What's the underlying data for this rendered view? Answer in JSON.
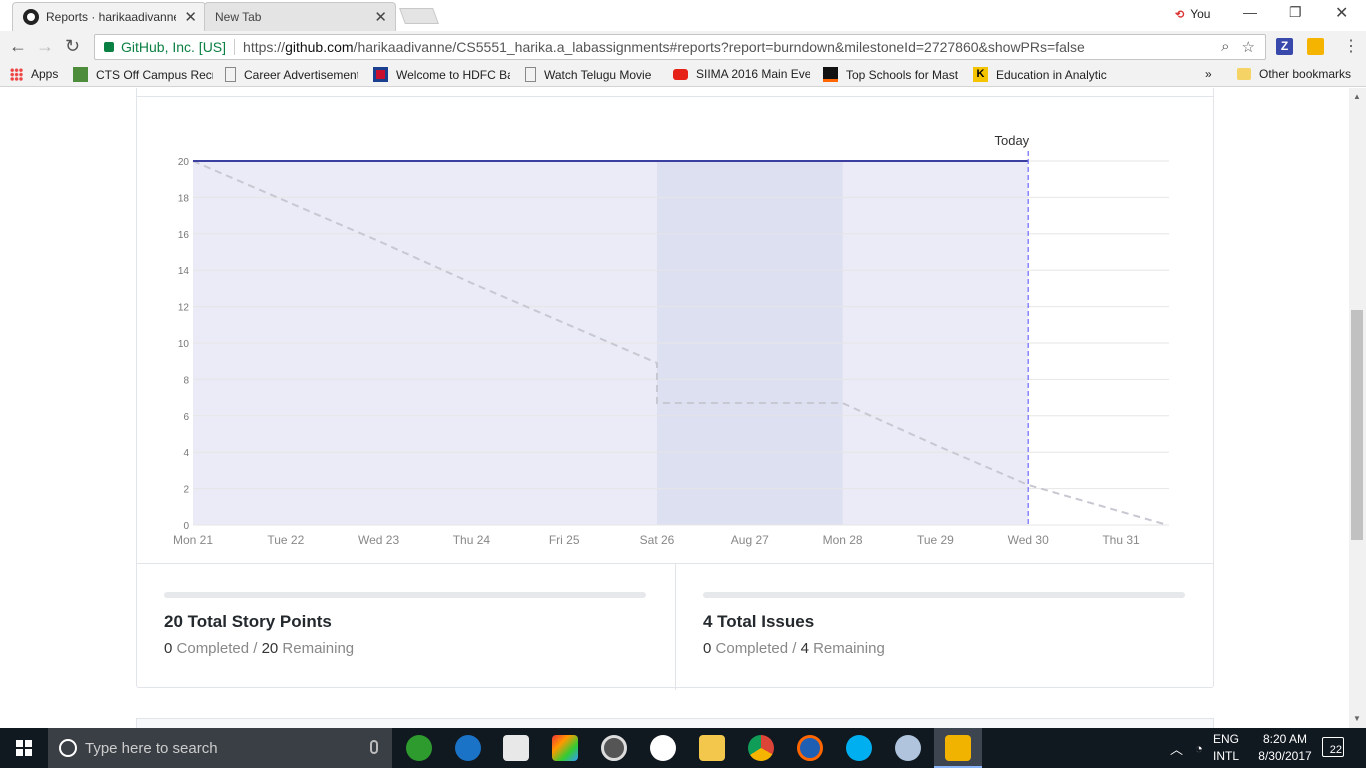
{
  "browser": {
    "tabs": [
      {
        "label": "Reports · harikaadivanne",
        "active": true
      },
      {
        "label": "New Tab",
        "active": false
      }
    ],
    "profile_label": "You",
    "security_label": "GitHub, Inc. [US]",
    "url_prefix": "https://",
    "url_host": "github.com",
    "url_path": "/harikaadivanne/CS5551_harika.a_labassignments#reports?report=burndown&milestoneId=2727860&showPRs=false",
    "extension_z_label": "Z"
  },
  "bookmarks": {
    "items": [
      {
        "label": "Apps",
        "icon": "apps-grid-icon"
      },
      {
        "label": "CTS Off Campus Recr",
        "icon": "checklist-icon"
      },
      {
        "label": "Career Advertisement",
        "icon": "page-icon"
      },
      {
        "label": "Welcome to HDFC Ba",
        "icon": "hdfc-icon"
      },
      {
        "label": "Watch Telugu Movie",
        "icon": "page-icon"
      },
      {
        "label": "SIIMA 2016 Main Eve",
        "icon": "youtube-icon"
      },
      {
        "label": "Top Schools for Mast",
        "icon": "wave-icon"
      },
      {
        "label": "Education in Analytic",
        "icon": "k-icon"
      }
    ],
    "overflow_label": "»",
    "other_label": "Other bookmarks"
  },
  "chart_data": {
    "type": "line",
    "title": "",
    "xlabel": "",
    "ylabel": "",
    "ylim": [
      0,
      20
    ],
    "y_ticks": [
      0,
      2,
      4,
      6,
      8,
      10,
      12,
      14,
      16,
      18,
      20
    ],
    "categories": [
      "Mon 21",
      "Tue 22",
      "Wed 23",
      "Thu 24",
      "Fri 25",
      "Sat 26",
      "Aug 27",
      "Mon 28",
      "Tue 29",
      "Wed 30",
      "Thu 31"
    ],
    "series": [
      {
        "values": [
          20,
          20,
          20,
          20,
          20,
          20,
          20,
          20,
          20,
          20
        ],
        "color": "#3b40a0",
        "style": "solid"
      },
      {
        "values": [
          20,
          17.8,
          15.6,
          13.3,
          11.1,
          8.9,
          6.7,
          6.7,
          6.7,
          4.4,
          2.2,
          0
        ],
        "x_index": [
          0,
          1,
          2,
          3,
          4,
          5,
          5,
          6,
          7,
          8,
          9,
          10.5
        ],
        "color": "#c8c8d2",
        "style": "dashed"
      }
    ],
    "today_label": "Today",
    "today_index": 9,
    "weekend_band": [
      5,
      7
    ],
    "grid": true
  },
  "stats": {
    "points": {
      "title": "20 Total Story Points",
      "completed_value": "0",
      "completed_label": "Completed /",
      "remaining_value": "20",
      "remaining_label": "Remaining",
      "progress": 0
    },
    "issues": {
      "title": "4 Total Issues",
      "completed_value": "0",
      "completed_label": "Completed /",
      "remaining_value": "4",
      "remaining_label": "Remaining",
      "progress": 0
    }
  },
  "taskbar": {
    "search_placeholder": "Type here to search",
    "language_top": "ENG",
    "language_bottom": "INTL",
    "time": "8:20 AM",
    "date": "8/30/2017",
    "notification_count": "22"
  }
}
